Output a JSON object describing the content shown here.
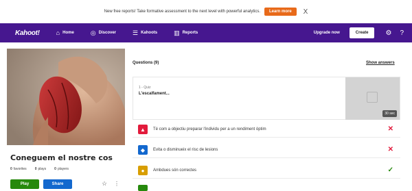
{
  "banner": {
    "text": "New free reports! Take formative assessment to the next level with powerful analytics.",
    "learn_more": "Learn more",
    "close": "X"
  },
  "nav": {
    "logo": "Kahoot!",
    "items": [
      {
        "label": "Home",
        "icon": "home-icon"
      },
      {
        "label": "Discover",
        "icon": "compass-icon"
      },
      {
        "label": "Kahoots",
        "icon": "list-icon"
      },
      {
        "label": "Reports",
        "icon": "bar-chart-icon"
      }
    ],
    "upgrade": "Upgrade now",
    "create": "Create",
    "brand_color": "#46178f"
  },
  "kahoot": {
    "title": "Coneguem el nostre cos",
    "favorites_count": "0",
    "favorites_label": "favorites",
    "plays_count": "0",
    "plays_label": "plays",
    "players_count": "0",
    "players_label": "players",
    "play": "Play",
    "share": "Share"
  },
  "questions": {
    "header": "Questions (9)",
    "show_answers": "Show answers",
    "first": {
      "type": "1 - Quiz",
      "text": "L'escalfament...",
      "time": "30 sec"
    },
    "answers": [
      {
        "text": "Té com a objectiu preparar l'individu per a un rendiment òptim",
        "shape": "triangle",
        "color": "#e21b3c",
        "mark": "✕",
        "mark_color": "#e21b3c"
      },
      {
        "text": "Evita o disminueix el risc de lesions",
        "shape": "diamond",
        "color": "#1368ce",
        "mark": "✕",
        "mark_color": "#e21b3c"
      },
      {
        "text": "Ambdues són correctes",
        "shape": "circle",
        "color": "#d89e00",
        "mark": "✓",
        "mark_color": "#26890c"
      }
    ]
  }
}
